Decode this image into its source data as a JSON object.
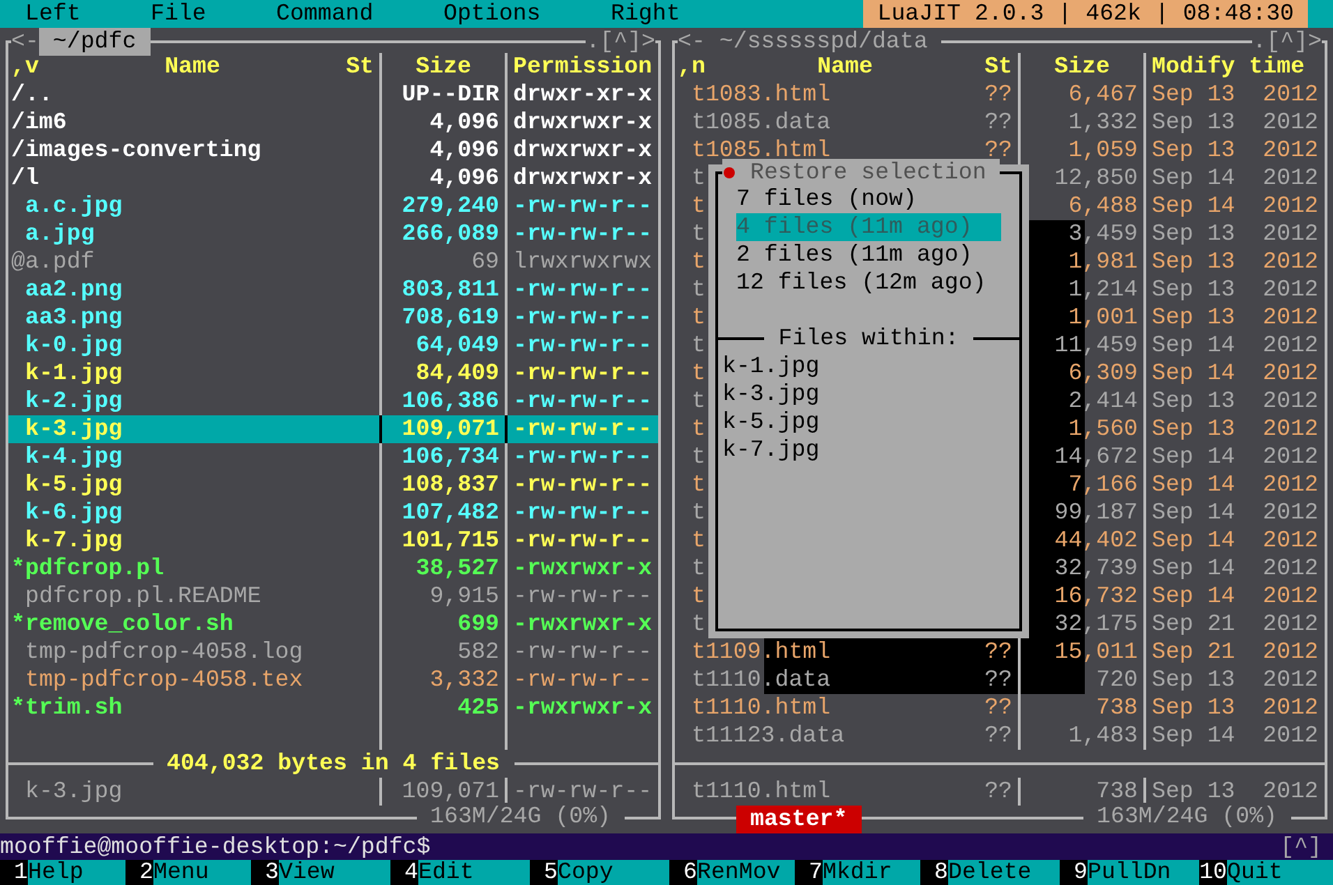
{
  "menu_bar": {
    "items": [
      "Left",
      "File",
      "Command",
      "Options",
      "Right"
    ],
    "status": "LuaJIT 2.0.3 | 462k | 08:48:30"
  },
  "left_panel": {
    "active": true,
    "back": "<-",
    "path": "~/pdfc",
    "history": ".[^]>",
    "columns": {
      "sort": ",v",
      "name": "Name",
      "status": "St",
      "size": "Size",
      "info": "Permission"
    },
    "files": [
      {
        "name": "/..",
        "size": "UP--DIR",
        "permissions": "drwxr-xr-x",
        "kind": "dir",
        "marked": false,
        "selected": false
      },
      {
        "name": "/im6",
        "size": "4,096",
        "permissions": "drwxrwxr-x",
        "kind": "dir",
        "marked": false,
        "selected": false
      },
      {
        "name": "/images-converting",
        "size": "4,096",
        "permissions": "drwxrwxr-x",
        "kind": "dir",
        "marked": false,
        "selected": false
      },
      {
        "name": "/l",
        "size": "4,096",
        "permissions": "drwxrwxr-x",
        "kind": "dir",
        "marked": false,
        "selected": false
      },
      {
        "name": "a.c.jpg",
        "size": "279,240",
        "permissions": "-rw-rw-r--",
        "kind": "image",
        "marked": false,
        "selected": false
      },
      {
        "name": "a.jpg",
        "size": "266,089",
        "permissions": "-rw-rw-r--",
        "kind": "image",
        "marked": false,
        "selected": false
      },
      {
        "name": "@a.pdf",
        "size": "69",
        "permissions": "lrwxrwxrwx",
        "kind": "link",
        "marked": false,
        "selected": false
      },
      {
        "name": "aa2.png",
        "size": "803,811",
        "permissions": "-rw-rw-r--",
        "kind": "image",
        "marked": false,
        "selected": false
      },
      {
        "name": "aa3.png",
        "size": "708,619",
        "permissions": "-rw-rw-r--",
        "kind": "image",
        "marked": false,
        "selected": false
      },
      {
        "name": "k-0.jpg",
        "size": "64,049",
        "permissions": "-rw-rw-r--",
        "kind": "image",
        "marked": false,
        "selected": false
      },
      {
        "name": "k-1.jpg",
        "size": "84,409",
        "permissions": "-rw-rw-r--",
        "kind": "image",
        "marked": true,
        "selected": false
      },
      {
        "name": "k-2.jpg",
        "size": "106,386",
        "permissions": "-rw-rw-r--",
        "kind": "image",
        "marked": false,
        "selected": false
      },
      {
        "name": "k-3.jpg",
        "size": "109,071",
        "permissions": "-rw-rw-r--",
        "kind": "image",
        "marked": true,
        "selected": true
      },
      {
        "name": "k-4.jpg",
        "size": "106,734",
        "permissions": "-rw-rw-r--",
        "kind": "image",
        "marked": false,
        "selected": false
      },
      {
        "name": "k-5.jpg",
        "size": "108,837",
        "permissions": "-rw-rw-r--",
        "kind": "image",
        "marked": true,
        "selected": false
      },
      {
        "name": "k-6.jpg",
        "size": "107,482",
        "permissions": "-rw-rw-r--",
        "kind": "image",
        "marked": false,
        "selected": false
      },
      {
        "name": "k-7.jpg",
        "size": "101,715",
        "permissions": "-rw-rw-r--",
        "kind": "image",
        "marked": true,
        "selected": false
      },
      {
        "name": "*pdfcrop.pl",
        "size": "38,527",
        "permissions": "-rwxrwxr-x",
        "kind": "executable",
        "marked": false,
        "selected": false
      },
      {
        "name": "pdfcrop.pl.README",
        "size": "9,915",
        "permissions": "-rw-rw-r--",
        "kind": "text",
        "marked": false,
        "selected": false
      },
      {
        "name": "*remove_color.sh",
        "size": "699",
        "permissions": "-rwxrwxr-x",
        "kind": "executable",
        "marked": false,
        "selected": false
      },
      {
        "name": "tmp-pdfcrop-4058.log",
        "size": "582",
        "permissions": "-rw-rw-r--",
        "kind": "text",
        "marked": false,
        "selected": false
      },
      {
        "name": "tmp-pdfcrop-4058.tex",
        "size": "3,332",
        "permissions": "-rw-rw-r--",
        "kind": "source",
        "marked": false,
        "selected": false
      },
      {
        "name": "*trim.sh",
        "size": "425",
        "permissions": "-rwxrwxr-x",
        "kind": "executable",
        "marked": false,
        "selected": false
      }
    ],
    "summary": "404,032 bytes in 4 files",
    "mini_status": {
      "name": "k-3.jpg",
      "size": "109,071",
      "info": "-rw-rw-r--"
    },
    "free_space": "163M/24G (0%)"
  },
  "right_panel": {
    "active": false,
    "back": "<-",
    "path": "~/sssssspd/data",
    "history": ".[^]>",
    "columns": {
      "sort": ",n",
      "name": "Name",
      "status": "St",
      "size": "Size",
      "info": "Modify time"
    },
    "files": [
      {
        "name": "t1083.html",
        "status": "??",
        "size": "6,467",
        "modified": "Sep 13  2012",
        "kind": "html"
      },
      {
        "name": "t1085.data",
        "status": "??",
        "size": "1,332",
        "modified": "Sep 13  2012",
        "kind": "data"
      },
      {
        "name": "t1085.html",
        "status": "??",
        "size": "1,059",
        "modified": "Sep 13  2012",
        "kind": "html"
      },
      {
        "name": "t",
        "size": "12,850",
        "modified": "Sep 14  2012",
        "kind": "data"
      },
      {
        "name": "t",
        "size": "6,488",
        "modified": "Sep 14  2012",
        "kind": "html"
      },
      {
        "name": "t",
        "size": "3,459",
        "modified": "Sep 13  2012",
        "kind": "data"
      },
      {
        "name": "t",
        "size": "1,981",
        "modified": "Sep 13  2012",
        "kind": "html"
      },
      {
        "name": "t",
        "size": "1,214",
        "modified": "Sep 13  2012",
        "kind": "data"
      },
      {
        "name": "t",
        "size": "1,001",
        "modified": "Sep 13  2012",
        "kind": "html"
      },
      {
        "name": "t",
        "size": "11,459",
        "modified": "Sep 14  2012",
        "kind": "data"
      },
      {
        "name": "t",
        "size": "6,309",
        "modified": "Sep 14  2012",
        "kind": "html"
      },
      {
        "name": "t",
        "size": "2,414",
        "modified": "Sep 13  2012",
        "kind": "data"
      },
      {
        "name": "t",
        "size": "1,560",
        "modified": "Sep 13  2012",
        "kind": "html"
      },
      {
        "name": "t",
        "size": "14,672",
        "modified": "Sep 14  2012",
        "kind": "data"
      },
      {
        "name": "t",
        "size": "7,166",
        "modified": "Sep 14  2012",
        "kind": "html"
      },
      {
        "name": "t",
        "size": "99,187",
        "modified": "Sep 14  2012",
        "kind": "data"
      },
      {
        "name": "t",
        "size": "44,402",
        "modified": "Sep 14  2012",
        "kind": "html"
      },
      {
        "name": "t",
        "size": "32,739",
        "modified": "Sep 14  2012",
        "kind": "data"
      },
      {
        "name": "t",
        "size": "16,732",
        "modified": "Sep 14  2012",
        "kind": "html"
      },
      {
        "name": "t",
        "size": "32,175",
        "modified": "Sep 21  2012",
        "kind": "data"
      },
      {
        "name": "t1109.html",
        "status": "??",
        "size": "15,011",
        "modified": "Sep 21  2012",
        "kind": "html"
      },
      {
        "name": "t1110.data",
        "status": "??",
        "size": "720",
        "modified": "Sep 13  2012",
        "kind": "data"
      },
      {
        "name": "t1110.html",
        "status": "??",
        "size": "738",
        "modified": "Sep 13  2012",
        "kind": "html"
      },
      {
        "name": "t11123.data",
        "status": "??",
        "size": "1,483",
        "modified": "Sep 14  2012",
        "kind": "data"
      }
    ],
    "mini_status": {
      "name": "t1110.html",
      "status": "??",
      "size": "738",
      "info": "Sep 13  2012"
    },
    "free_space": "163M/24G (0%)",
    "branch": "master*"
  },
  "dialog": {
    "title": "Restore selection",
    "items": [
      {
        "label": "7 files (now)",
        "selected": false
      },
      {
        "label": "4 files (11m ago)",
        "selected": true
      },
      {
        "label": "2 files (11m ago)",
        "selected": false
      },
      {
        "label": "12 files (12m ago)",
        "selected": false
      }
    ],
    "section": "Files within:",
    "files": [
      "k-1.jpg",
      "k-3.jpg",
      "k-5.jpg",
      "k-7.jpg"
    ]
  },
  "command_line": {
    "prompt": "mooffie@mooffie-desktop:~/pdfc$",
    "history": "[^]"
  },
  "function_keys": [
    {
      "number": "1",
      "label": "Help"
    },
    {
      "number": "2",
      "label": "Menu"
    },
    {
      "number": "3",
      "label": "View"
    },
    {
      "number": "4",
      "label": "Edit"
    },
    {
      "number": "5",
      "label": "Copy"
    },
    {
      "number": "6",
      "label": "RenMov"
    },
    {
      "number": "7",
      "label": "Mkdir"
    },
    {
      "number": "8",
      "label": "Delete"
    },
    {
      "number": "9",
      "label": "PullDn"
    },
    {
      "number": "10",
      "label": "Quit"
    }
  ]
}
